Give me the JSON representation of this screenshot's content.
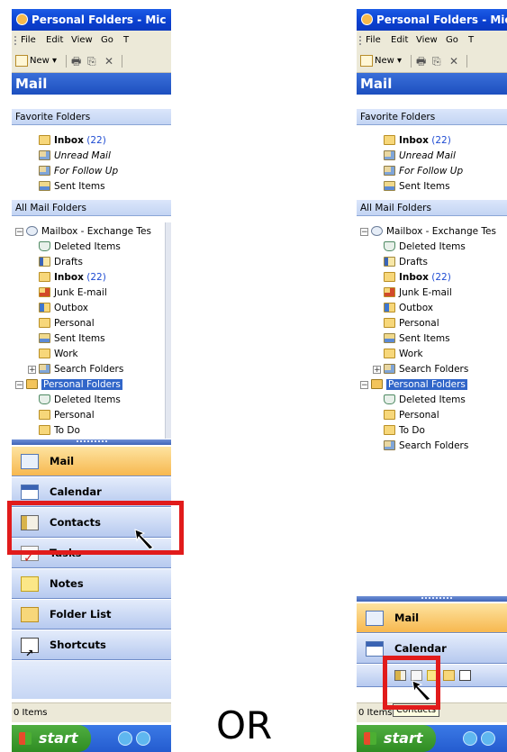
{
  "title": "Personal Folders - Mic",
  "menu": [
    "File",
    "Edit",
    "View",
    "Go",
    "T"
  ],
  "toolbar": {
    "new_label": "New"
  },
  "pane_title": "Mail",
  "favorite_header": "Favorite Folders",
  "favorites": [
    {
      "label": "Inbox",
      "count": "(22)",
      "icon": "inbox-icon"
    },
    {
      "label": "Unread Mail",
      "count": "",
      "icon": "search-folder-icon"
    },
    {
      "label": "For Follow Up",
      "count": "",
      "icon": "search-folder-icon"
    },
    {
      "label": "Sent Items",
      "count": "",
      "icon": "sent-items-icon"
    }
  ],
  "all_header": "All Mail Folders",
  "tree": {
    "mailbox": "Mailbox - Exchange Tes",
    "mailbox_items": [
      {
        "label": "Deleted Items",
        "count": "",
        "icon": "deleted-items-icon"
      },
      {
        "label": "Drafts",
        "count": "",
        "icon": "drafts-icon"
      },
      {
        "label": "Inbox",
        "count": "(22)",
        "icon": "inbox-icon"
      },
      {
        "label": "Junk E-mail",
        "count": "",
        "icon": "junk-email-icon"
      },
      {
        "label": "Outbox",
        "count": "",
        "icon": "outbox-icon"
      },
      {
        "label": "Personal",
        "count": "",
        "icon": "folder-icon"
      },
      {
        "label": "Sent Items",
        "count": "",
        "icon": "sent-items-icon"
      },
      {
        "label": "Work",
        "count": "",
        "icon": "folder-icon"
      },
      {
        "label": "Search Folders",
        "count": "",
        "icon": "search-folder-icon"
      }
    ],
    "personal": "Personal Folders",
    "personal_items_left": [
      {
        "label": "Deleted Items",
        "icon": "deleted-items-icon"
      },
      {
        "label": "Personal",
        "icon": "folder-icon"
      },
      {
        "label": "To Do",
        "icon": "folder-icon"
      }
    ],
    "personal_items_right": [
      {
        "label": "Deleted Items",
        "icon": "deleted-items-icon"
      },
      {
        "label": "Personal",
        "icon": "folder-icon"
      },
      {
        "label": "To Do",
        "icon": "folder-icon"
      },
      {
        "label": "Search Folders",
        "icon": "search-folder-icon"
      }
    ]
  },
  "nav_left": [
    "Mail",
    "Calendar",
    "Contacts",
    "Tasks",
    "Notes",
    "Folder List",
    "Shortcuts"
  ],
  "nav_right": [
    "Mail",
    "Calendar"
  ],
  "status_text": "0 Items",
  "start_label": "start",
  "or_label": "OR",
  "tooltip": "Contacts"
}
